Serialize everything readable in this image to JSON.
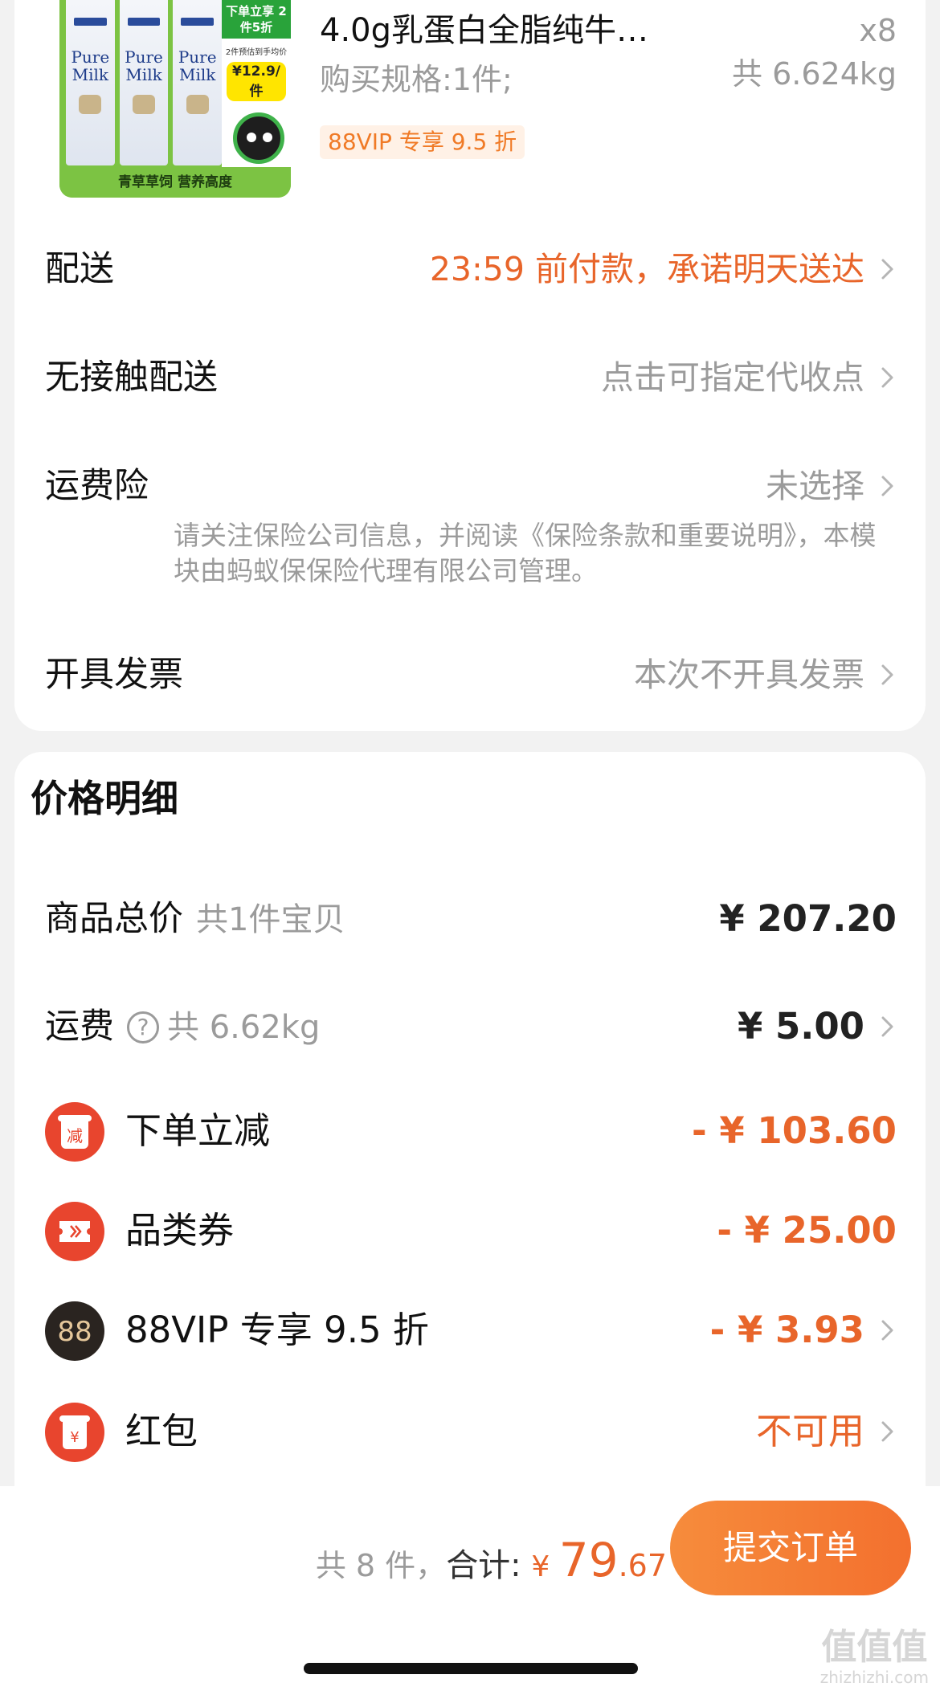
{
  "product": {
    "title": "4.0g乳蛋白全脂纯牛…",
    "quantity": "x8",
    "spec": "购买规格:1件;",
    "weight": "共 6.624kg",
    "vip_tag": "88VIP 专享 9.5 折",
    "image": {
      "carton_text": "Pure Milk",
      "promo_head": "下单立享 2件5折",
      "promo_sub": "2件预估到手均价",
      "promo_price": "¥12.9/件",
      "banner": "青草草饲 营养高度"
    }
  },
  "order_options": {
    "delivery": {
      "label": "配送",
      "value": "23:59 前付款，承诺明天送达"
    },
    "contactless": {
      "label": "无接触配送",
      "value": "点击可指定代收点"
    },
    "shipping_insurance": {
      "label": "运费险",
      "value": "未选择",
      "note": "请关注保险公司信息，并阅读《保险条款和重要说明》，本模块由蚂蚁保保险代理有限公司管理。"
    },
    "invoice": {
      "label": "开具发票",
      "value": "本次不开具发票"
    }
  },
  "price_detail": {
    "title": "价格明细",
    "goods_total": {
      "label": "商品总价",
      "sub": "共1件宝贝",
      "value": "¥ 207.20"
    },
    "shipping": {
      "label": "运费",
      "sub": "共 6.62kg",
      "value": "¥ 5.00"
    },
    "instant_discount": {
      "icon_text": "减",
      "label": "下单立减",
      "value": "- ¥ 103.60"
    },
    "category_coupon": {
      "label": "品类券",
      "value": "- ¥ 25.00"
    },
    "vip_discount": {
      "icon_text": "88",
      "label": "88VIP 专享 9.5 折",
      "value": "- ¥ 3.93"
    },
    "red_packet": {
      "icon_text": "¥",
      "label": "红包",
      "value": "不可用"
    }
  },
  "footer": {
    "count": "共 8 件，",
    "total_label": "合计: ",
    "currency": "¥ ",
    "total_int": "79",
    "total_dec": ".67",
    "submit": "提交订单"
  },
  "watermark": {
    "text": "值值值",
    "url": "zhizhizhi.com"
  },
  "colors": {
    "accent_orange": "#e8652a",
    "muted_gray": "#9b9b9b",
    "icon_red": "#e8452e",
    "page_bg": "#f2f2f2"
  }
}
